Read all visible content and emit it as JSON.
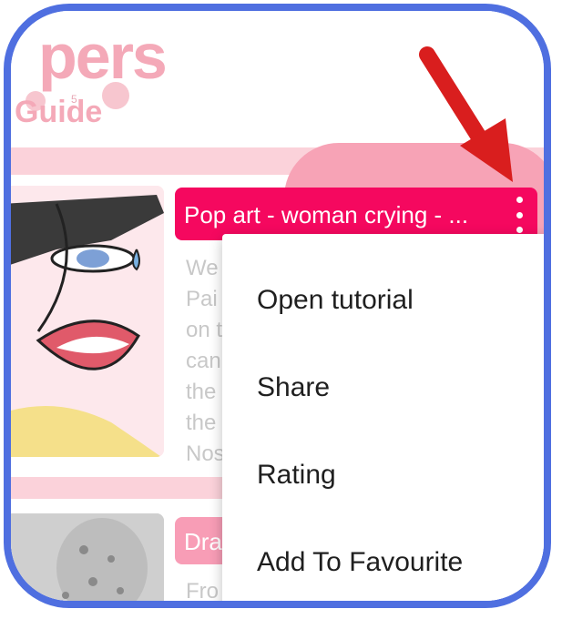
{
  "header": {
    "title": "pers",
    "subtitle": "Guide",
    "mini_number": "5"
  },
  "card1": {
    "title": "Pop art - woman crying - ...",
    "description_lines": [
      "We",
      "Pai",
      "on t",
      "can",
      "the",
      "the",
      "Nos"
    ]
  },
  "card2": {
    "title": "Dra",
    "description": "Fro"
  },
  "menu": {
    "items": [
      {
        "label": "Open tutorial"
      },
      {
        "label": "Share"
      },
      {
        "label": "Rating"
      },
      {
        "label": "Add To Favourite"
      }
    ]
  },
  "colors": {
    "frame": "#4f6fe0",
    "accent": "#f5085f",
    "arrow": "#d91e1e"
  },
  "icons": {
    "overflow": "more-vert-icon",
    "annotation": "arrow-icon"
  }
}
